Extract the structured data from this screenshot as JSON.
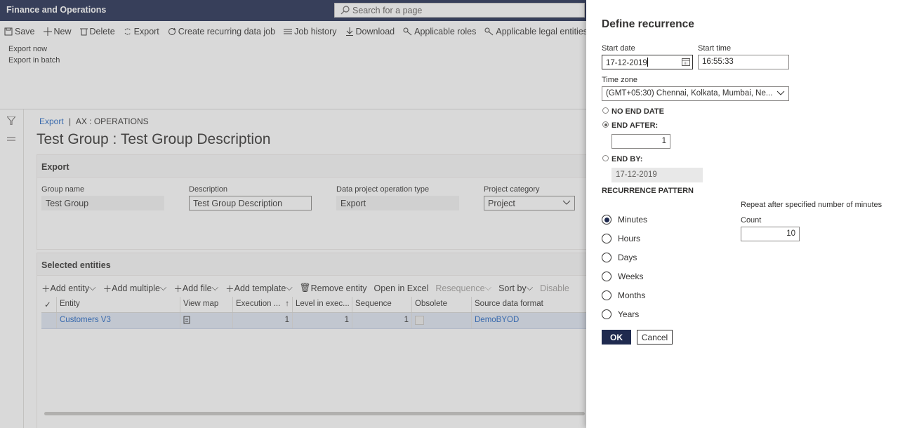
{
  "app": {
    "title": "Finance and Operations",
    "search_placeholder": "Search for a page"
  },
  "actionbar": {
    "items": [
      {
        "label": "Save",
        "icon": "save-icon"
      },
      {
        "label": "New",
        "icon": "plus-icon"
      },
      {
        "label": "Delete",
        "icon": "trash-icon"
      },
      {
        "label": "Export",
        "icon": "export-icon"
      },
      {
        "label": "Create recurring data job",
        "icon": "recurring-icon"
      },
      {
        "label": "Job history",
        "icon": "list-icon"
      },
      {
        "label": "Download",
        "icon": "download-icon"
      },
      {
        "label": "Applicable roles",
        "icon": "key-icon"
      },
      {
        "label": "Applicable legal entities",
        "icon": "key-icon"
      }
    ]
  },
  "export_menu": {
    "items": [
      "Export now",
      "Export in batch"
    ]
  },
  "breadcrumb": {
    "link": "Export",
    "separator": "|",
    "current": "AX : OPERATIONS"
  },
  "page": {
    "title": "Test Group : Test Group Description"
  },
  "export_tab": {
    "header": "Export",
    "fields": [
      {
        "label": "Group name",
        "value": "Test Group"
      },
      {
        "label": "Description",
        "value": "Test Group Description"
      },
      {
        "label": "Data project operation type",
        "value": "Export"
      },
      {
        "label": "Project category",
        "value": "Project"
      }
    ]
  },
  "entities_tab": {
    "header": "Selected entities",
    "toolbar": [
      {
        "label": "Add entity",
        "plus": true,
        "chevron": true,
        "disabled": false
      },
      {
        "label": "Add multiple",
        "plus": true,
        "chevron": true,
        "disabled": false
      },
      {
        "label": "Add file",
        "plus": true,
        "chevron": true,
        "disabled": false
      },
      {
        "label": "Add template",
        "plus": true,
        "chevron": true,
        "disabled": false
      },
      {
        "label": "Remove entity",
        "trash": true,
        "chevron": false,
        "disabled": false
      },
      {
        "label": "Open in Excel",
        "plus": false,
        "chevron": false,
        "disabled": false
      },
      {
        "label": "Resequence",
        "plus": false,
        "chevron": true,
        "disabled": true
      },
      {
        "label": "Sort by",
        "plus": false,
        "chevron": true,
        "disabled": false
      },
      {
        "label": "Disable",
        "plus": false,
        "chevron": false,
        "disabled": true
      }
    ],
    "columns": [
      "Entity",
      "View map",
      "Execution ...",
      "Level in exec...",
      "Sequence",
      "Obsolete",
      "Source data format"
    ],
    "rows": [
      {
        "entity": "Customers V3",
        "execution": "1",
        "level": "1",
        "sequence": "1",
        "format": "DemoBYOD"
      }
    ]
  },
  "dialog": {
    "title": "Define recurrence",
    "start_date_label": "Start date",
    "start_date": "17-12-2019",
    "start_time_label": "Start time",
    "start_time": "16:55:33",
    "time_zone_label": "Time zone",
    "time_zone": "(GMT+05:30) Chennai, Kolkata, Mumbai, Ne...",
    "no_end_date": "NO END DATE",
    "end_after": "END AFTER:",
    "end_after_value": "1",
    "end_by": "END BY:",
    "end_by_value": "17-12-2019",
    "end_selected": "end_after",
    "pattern_heading": "RECURRENCE PATTERN",
    "pattern_options": [
      "Minutes",
      "Hours",
      "Days",
      "Weeks",
      "Months",
      "Years"
    ],
    "pattern_selected": "Minutes",
    "repeat_hint": "Repeat after specified number of minutes",
    "count_label": "Count",
    "count_value": "10",
    "ok_label": "OK",
    "cancel_label": "Cancel"
  },
  "colors": {
    "navy": "#1f2a4f",
    "link": "#2266c2",
    "row_selected": "#dfe6f3"
  }
}
